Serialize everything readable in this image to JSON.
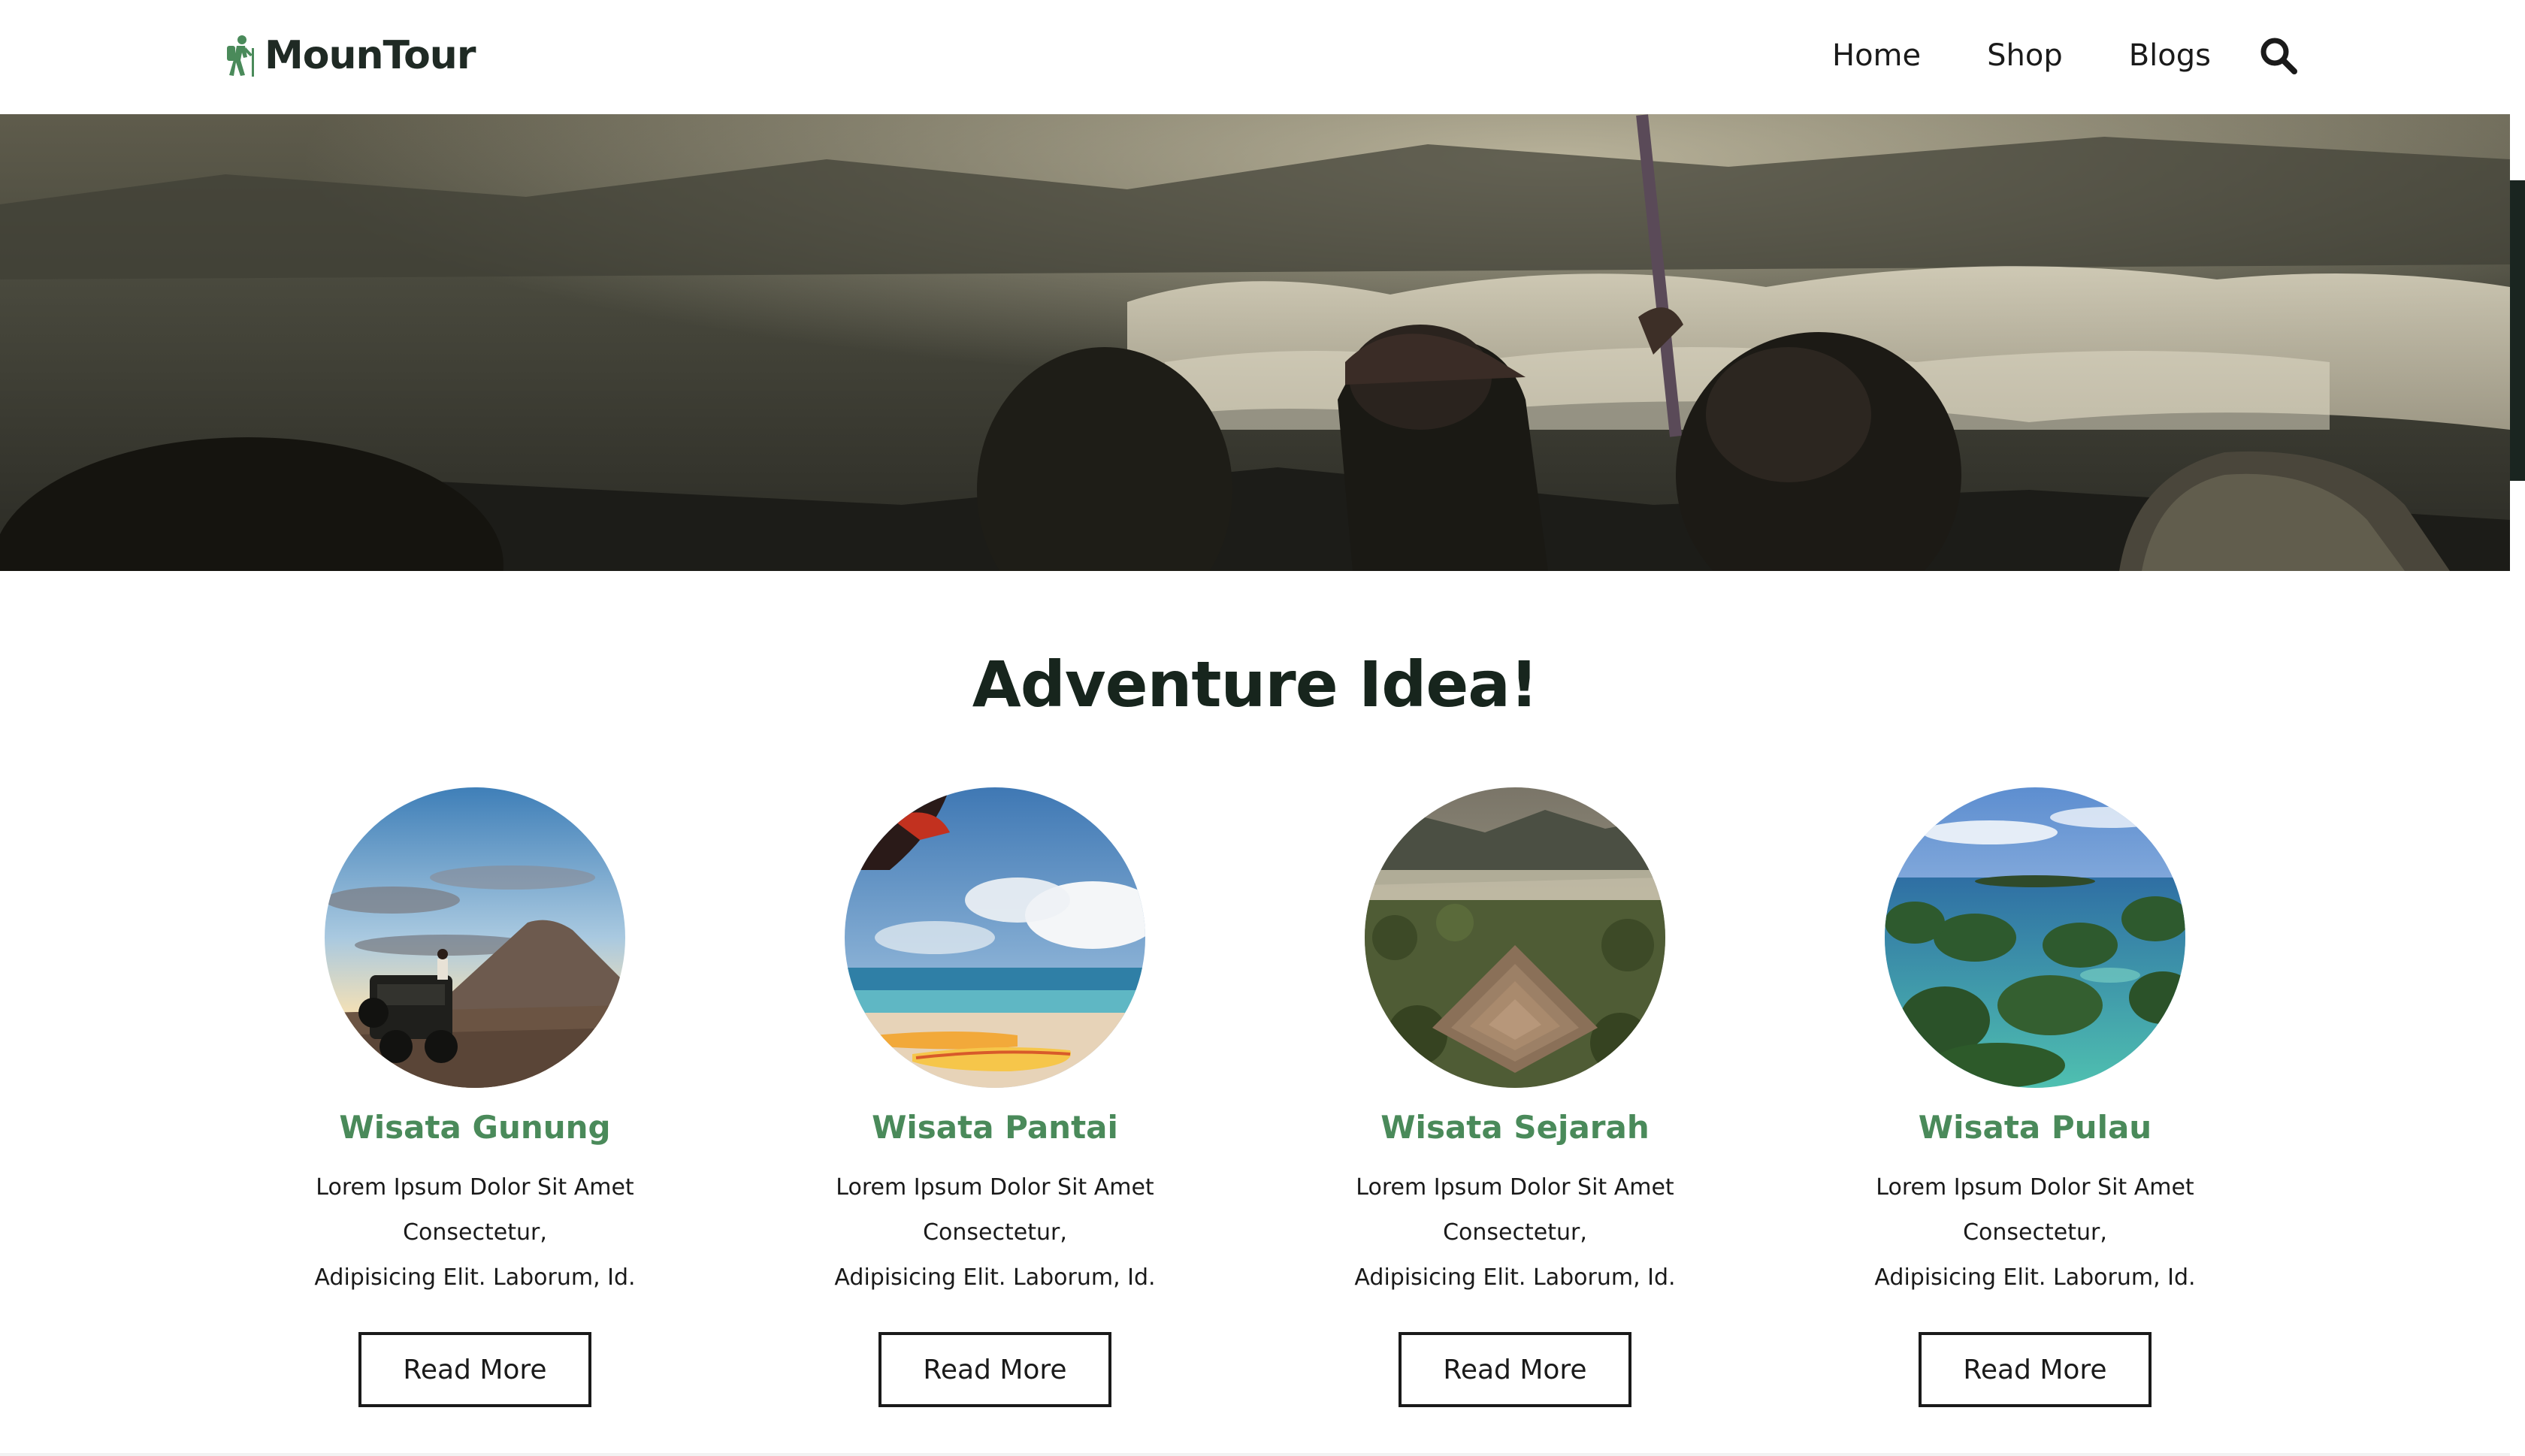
{
  "header": {
    "logo_text": "MounTour",
    "nav": [
      {
        "label": "Home"
      },
      {
        "label": "Shop"
      },
      {
        "label": "Blogs"
      }
    ],
    "search_icon": "search-icon"
  },
  "section": {
    "title": "Adventure Idea!"
  },
  "cards": [
    {
      "title": "Wisata Gunung",
      "text_line1": "Lorem Ipsum Dolor Sit Amet Consectetur,",
      "text_line2": "Adipisicing Elit. Laborum, Id.",
      "button": "Read More"
    },
    {
      "title": "Wisata Pantai",
      "text_line1": "Lorem Ipsum Dolor Sit Amet Consectetur,",
      "text_line2": "Adipisicing Elit. Laborum, Id.",
      "button": "Read More"
    },
    {
      "title": "Wisata Sejarah",
      "text_line1": "Lorem Ipsum Dolor Sit Amet Consectetur,",
      "text_line2": "Adipisicing Elit. Laborum, Id.",
      "button": "Read More"
    },
    {
      "title": "Wisata Pulau",
      "text_line1": "Lorem Ipsum Dolor Sit Amet Consectetur,",
      "text_line2": "Adipisicing Elit. Laborum, Id.",
      "button": "Read More"
    }
  ],
  "colors": {
    "brand_green": "#4a8a5a",
    "heading_dark": "#17251d"
  }
}
